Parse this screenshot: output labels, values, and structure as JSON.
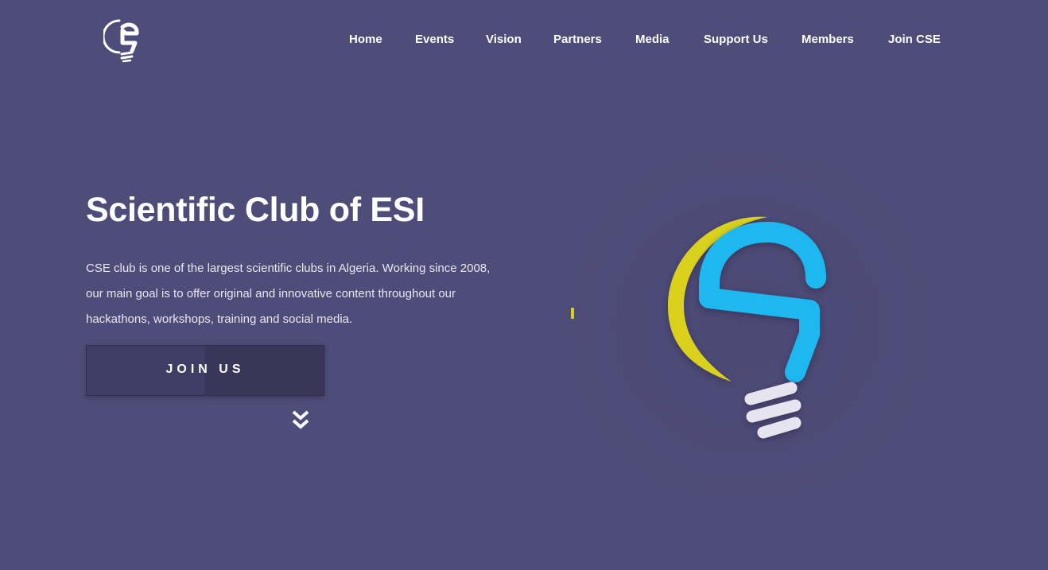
{
  "header": {
    "logo_icon": "cse-lightbulb-logo-icon",
    "nav": [
      {
        "label": "Home"
      },
      {
        "label": "Events"
      },
      {
        "label": "Vision"
      },
      {
        "label": "Partners"
      },
      {
        "label": "Media"
      },
      {
        "label": "Support Us"
      },
      {
        "label": "Members"
      },
      {
        "label": "Join CSE"
      }
    ]
  },
  "hero": {
    "title": "Scientific Club of ESI",
    "description": "CSE club is one of the largest scientific clubs in Algeria. Working since 2008, our main goal is to offer original and innovative content throughout our hackathons, workshops, training and social media.",
    "button_label": "JOIN US",
    "scroll_icon": "double-chevron-down-icon",
    "illustration_icon": "cse-lightbulb-illustration-icon"
  },
  "colors": {
    "background": "#4e4c78",
    "accent_blue": "#1ab8ef",
    "accent_yellow": "#d9d11a",
    "bulb_base": "#e6e4ee"
  }
}
